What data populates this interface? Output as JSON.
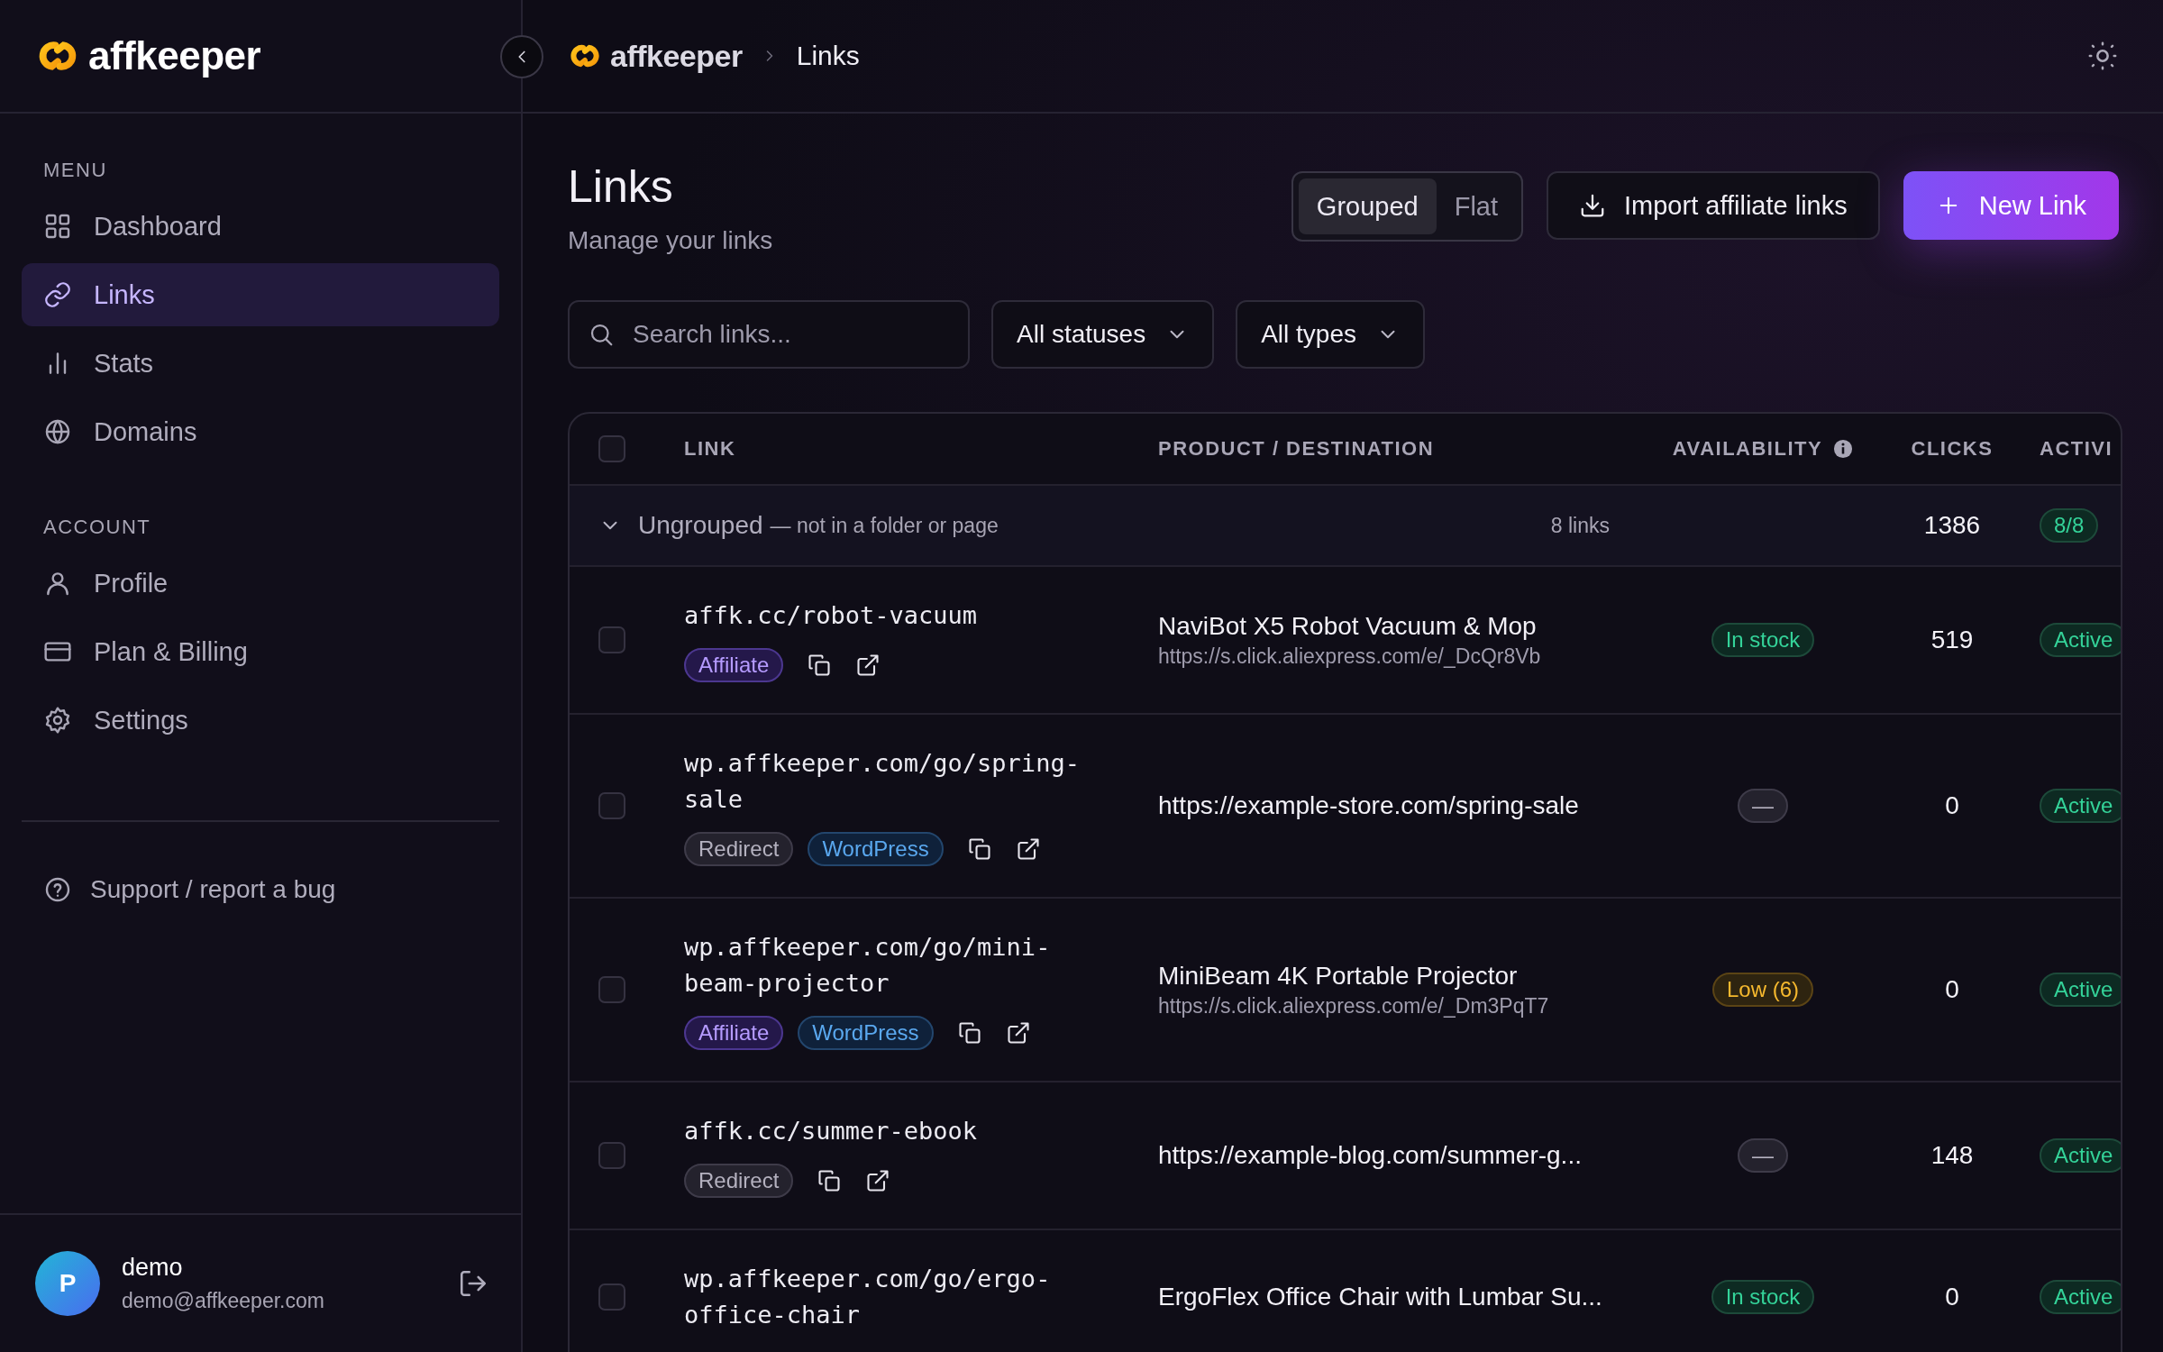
{
  "sidebar": {
    "brand": "affkeeper",
    "sections": [
      {
        "label": "MENU",
        "items": [
          {
            "label": "Dashboard",
            "selected": false
          },
          {
            "label": "Links",
            "selected": true
          },
          {
            "label": "Stats",
            "selected": false
          },
          {
            "label": "Domains",
            "selected": false
          }
        ]
      },
      {
        "label": "ACCOUNT",
        "items": [
          {
            "label": "Profile",
            "selected": false
          },
          {
            "label": "Plan & Billing",
            "selected": false
          },
          {
            "label": "Settings",
            "selected": false
          }
        ]
      }
    ],
    "support": "Support / report a bug",
    "user": {
      "initial": "P",
      "name": "demo",
      "email": "demo@affkeeper.com"
    }
  },
  "topbar": {
    "brand": "affkeeper",
    "breadcrumb": "Links"
  },
  "page": {
    "title": "Links",
    "subtitle": "Manage your links",
    "view_toggle": [
      {
        "label": "Grouped",
        "selected": true
      },
      {
        "label": "Flat",
        "selected": false
      }
    ],
    "import_button": "Import affiliate links",
    "new_button": "New Link",
    "search": {
      "placeholder": "Search links..."
    },
    "filters": [
      "All statuses",
      "All types"
    ]
  },
  "table": {
    "select_all": {
      "checked": false
    },
    "columns": [
      {
        "label": "LINK"
      },
      {
        "label": "PRODUCT / DESTINATION"
      },
      {
        "label": "AVAILABILITY",
        "info": true
      },
      {
        "label": "CLICKS"
      },
      {
        "label": "ACTIVI"
      }
    ],
    "group": {
      "expanded": true,
      "name": "Ungrouped",
      "note": "— not in a folder or page",
      "count": "8 links",
      "clicks": "1386",
      "active": "8/8"
    },
    "rows": [
      {
        "checked": false,
        "link": "affk.cc/robot-vacuum",
        "tags": [
          {
            "label": "Affiliate",
            "kind": "affiliate"
          }
        ],
        "product": "NaviBot X5 Robot Vacuum & Mop",
        "url": "https://s.click.aliexpress.com/e/_DcQr8Vb",
        "availability": {
          "label": "In stock",
          "kind": "in_stock"
        },
        "clicks": "519",
        "status": "Active"
      },
      {
        "checked": false,
        "link": "wp.affkeeper.com/go/spring-sale",
        "tags": [
          {
            "label": "Redirect",
            "kind": "redirect"
          },
          {
            "label": "WordPress",
            "kind": "wordpress"
          }
        ],
        "product": "https://example-store.com/spring-sale",
        "availability": {
          "label": "—",
          "kind": "none"
        },
        "clicks": "0",
        "status": "Active"
      },
      {
        "checked": false,
        "link": "wp.affkeeper.com/go/mini-beam-projector",
        "tags": [
          {
            "label": "Affiliate",
            "kind": "affiliate"
          },
          {
            "label": "WordPress",
            "kind": "wordpress"
          }
        ],
        "product": "MiniBeam 4K Portable Projector",
        "url": "https://s.click.aliexpress.com/e/_Dm3PqT7",
        "availability": {
          "label": "Low (6)",
          "kind": "low"
        },
        "clicks": "0",
        "status": "Active"
      },
      {
        "checked": false,
        "link": "affk.cc/summer-ebook",
        "tags": [
          {
            "label": "Redirect",
            "kind": "redirect"
          }
        ],
        "product": "https://example-blog.com/summer-g...",
        "availability": {
          "label": "—",
          "kind": "none"
        },
        "clicks": "148",
        "status": "Active"
      },
      {
        "checked": false,
        "link": "wp.affkeeper.com/go/ergo-office-chair",
        "tags": [],
        "product": "ErgoFlex Office Chair with Lumbar Su...",
        "availability": {
          "label": "In stock",
          "kind": "in_stock"
        },
        "clicks": "0",
        "status": "Active"
      }
    ]
  }
}
